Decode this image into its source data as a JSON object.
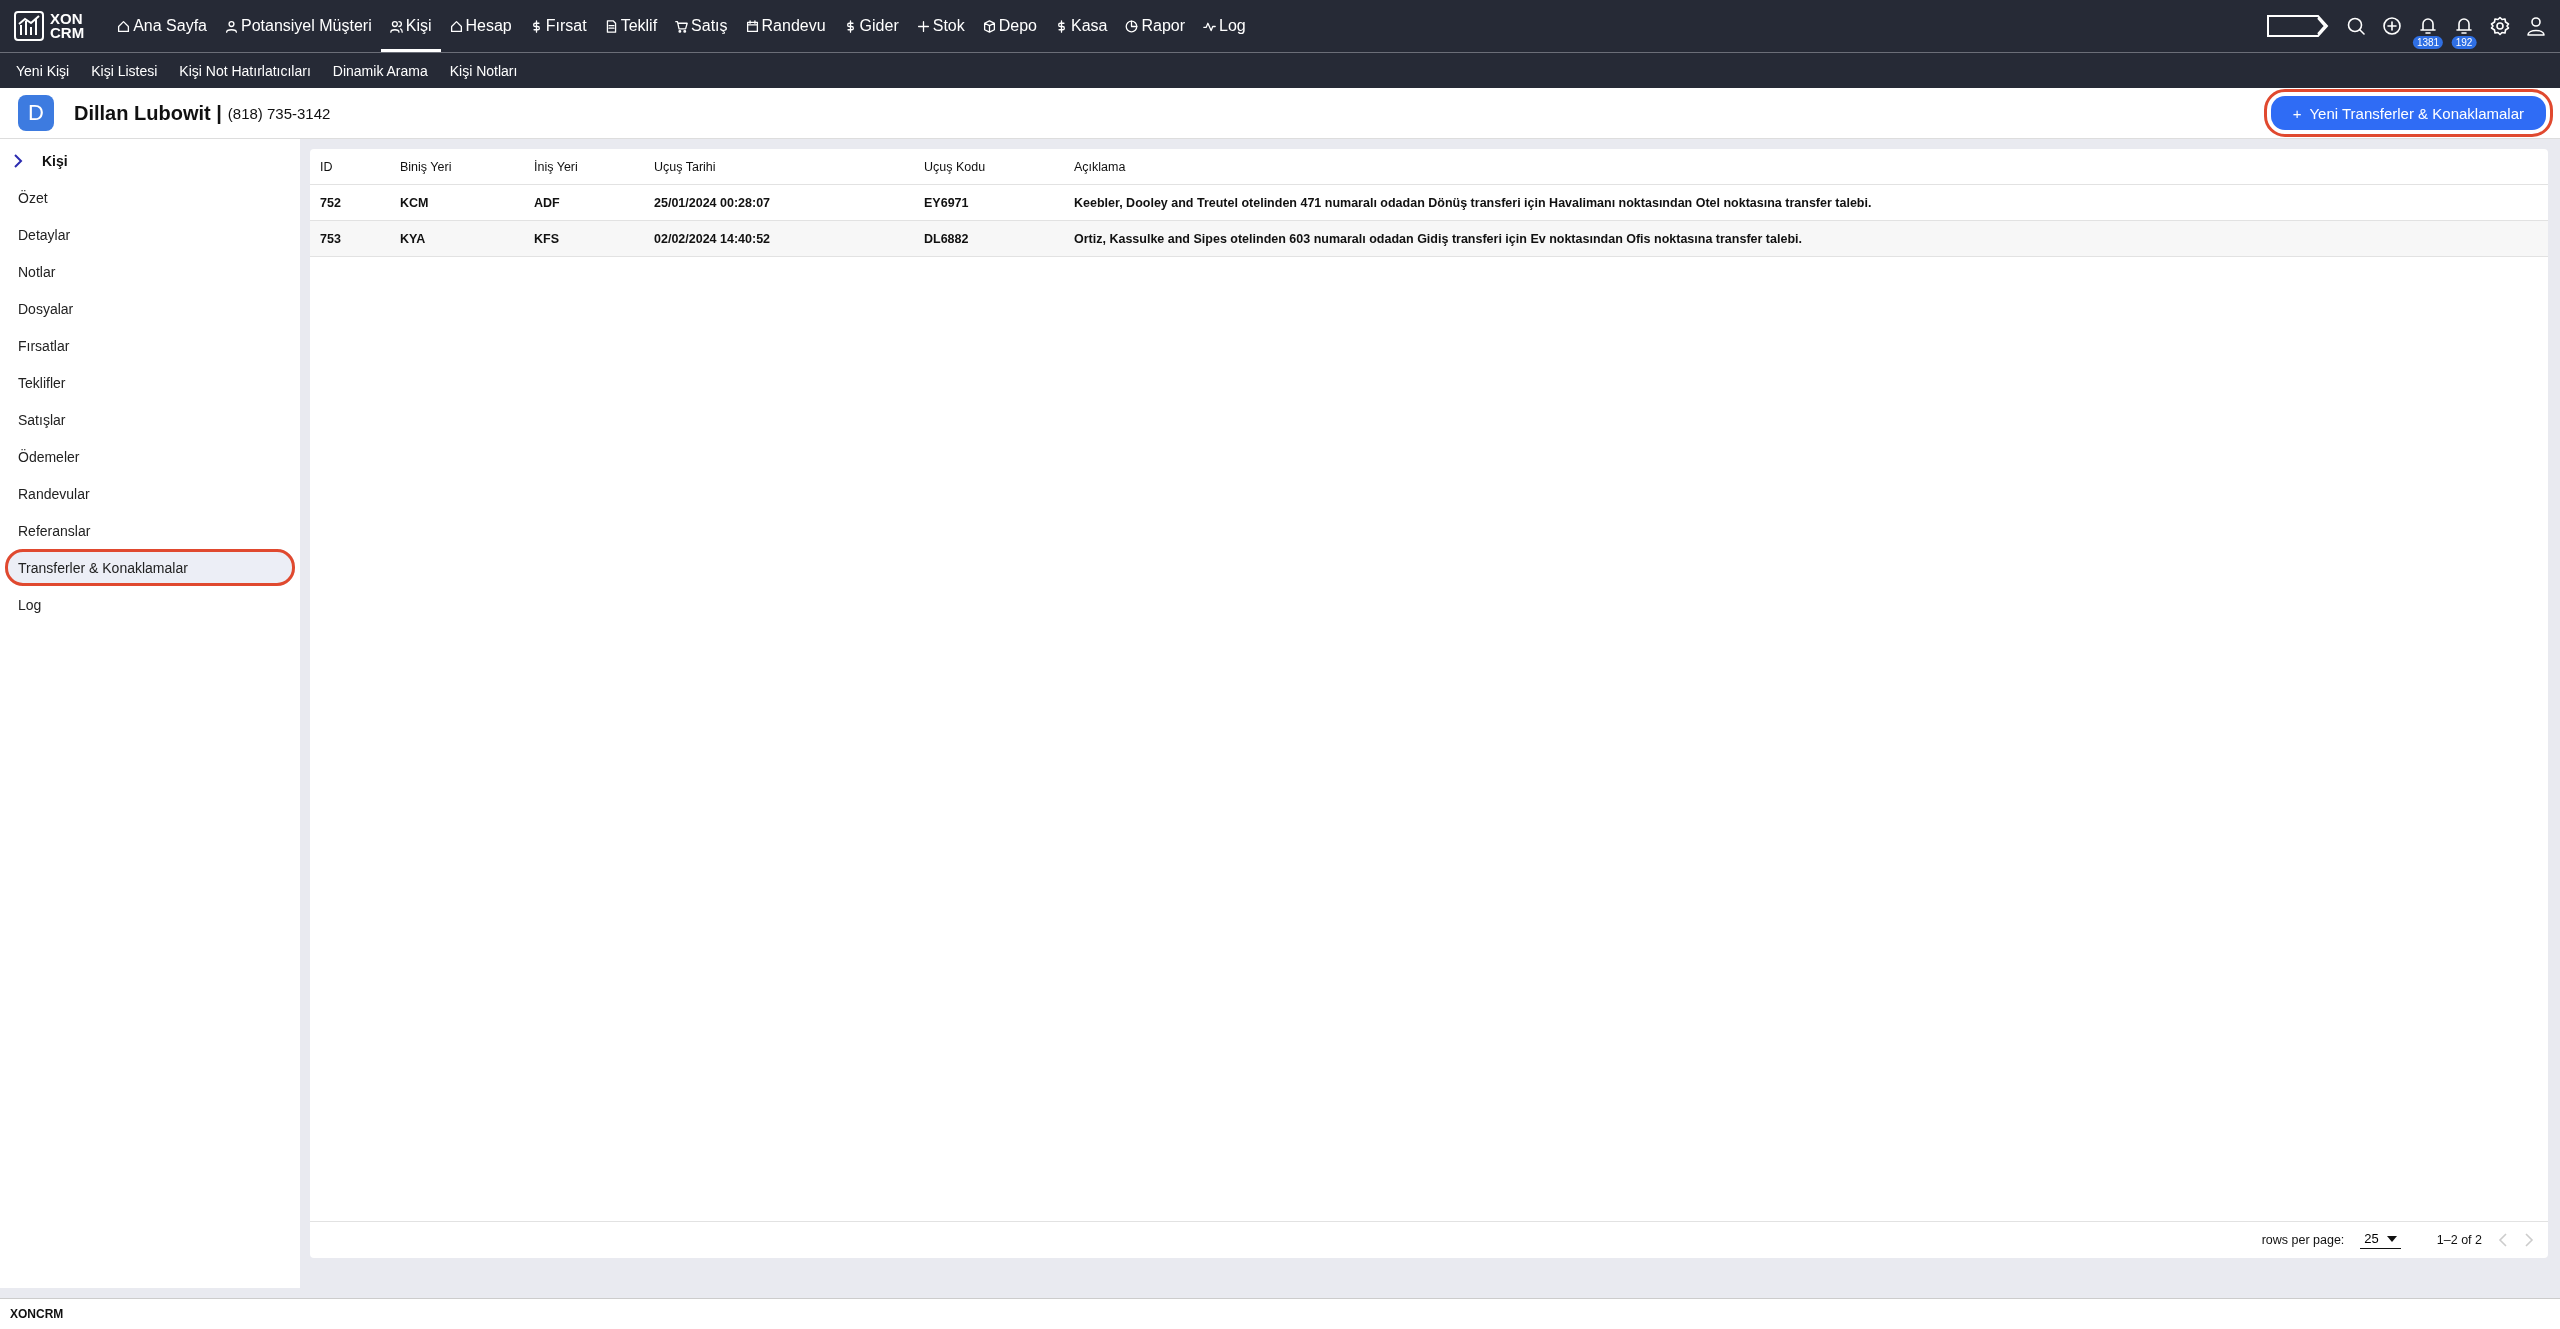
{
  "brand": {
    "line_1": "XON",
    "line_2": "CRM"
  },
  "nav": [
    {
      "label": "Ana Sayfa",
      "kind": "home",
      "selected": false
    },
    {
      "label": "Potansiyel Müşteri",
      "kind": "person",
      "selected": false
    },
    {
      "label": "Kişi",
      "kind": "people",
      "selected": true
    },
    {
      "label": "Hesap",
      "kind": "home",
      "selected": false
    },
    {
      "label": "Fırsat",
      "kind": "dollar",
      "selected": false
    },
    {
      "label": "Teklif",
      "kind": "doc",
      "selected": false
    },
    {
      "label": "Satış",
      "kind": "cart",
      "selected": false
    },
    {
      "label": "Randevu",
      "kind": "calendar",
      "selected": false
    },
    {
      "label": "Gider",
      "kind": "dollar",
      "selected": false
    },
    {
      "label": "Stok",
      "kind": "plus",
      "selected": false
    },
    {
      "label": "Depo",
      "kind": "box",
      "selected": false
    },
    {
      "label": "Kasa",
      "kind": "dollar",
      "selected": false
    },
    {
      "label": "Rapor",
      "kind": "clock",
      "selected": false
    },
    {
      "label": "Log",
      "kind": "pulse",
      "selected": false
    }
  ],
  "toolbar": [
    {
      "kind": "arrow"
    },
    {
      "kind": "search"
    },
    {
      "kind": "add"
    },
    {
      "kind": "bell",
      "badge": "1381"
    },
    {
      "kind": "bell",
      "badge": "192"
    },
    {
      "kind": "settings"
    },
    {
      "kind": "user"
    }
  ],
  "subnav": [
    "Yeni Kişi",
    "Kişi Listesi",
    "Kişi Not Hatırlatıcıları",
    "Dinamik Arama",
    "Kişi Notları"
  ],
  "contact": {
    "initial": "D",
    "name": "Dillan Lubowit |",
    "phone": "(818) 735-3142"
  },
  "new_button": {
    "icon": "+",
    "label": "Yeni Transferler & Konaklamalar",
    "annotated": true
  },
  "sidebar": {
    "title": "Kişi",
    "items": [
      {
        "label": "Özet",
        "selected": false,
        "annotated": false
      },
      {
        "label": "Detaylar",
        "selected": false,
        "annotated": false
      },
      {
        "label": "Notlar",
        "selected": false,
        "annotated": false
      },
      {
        "label": "Dosyalar",
        "selected": false,
        "annotated": false
      },
      {
        "label": "Fırsatlar",
        "selected": false,
        "annotated": false
      },
      {
        "label": "Teklifler",
        "selected": false,
        "annotated": false
      },
      {
        "label": "Satışlar",
        "selected": false,
        "annotated": false
      },
      {
        "label": "Ödemeler",
        "selected": false,
        "annotated": false
      },
      {
        "label": "Randevular",
        "selected": false,
        "annotated": false
      },
      {
        "label": "Referanslar",
        "selected": false,
        "annotated": false
      },
      {
        "label": "Transferler & Konaklamalar",
        "selected": true,
        "annotated": true
      },
      {
        "label": "Log",
        "selected": false,
        "annotated": false
      }
    ]
  },
  "table": {
    "columns": [
      "ID",
      "Biniş Yeri",
      "İniş Yeri",
      "Uçuş Tarihi",
      "Uçuş Kodu",
      "Açıklama"
    ],
    "rows": [
      [
        "752",
        "KCM",
        "ADF",
        "25/01/2024 00:28:07",
        "EY6971",
        "Keebler, Dooley and Treutel otelinden 471 numaralı odadan Dönüş transferi için Havalimanı noktasından Otel noktasına transfer talebi."
      ],
      [
        "753",
        "KYA",
        "KFS",
        "02/02/2024 14:40:52",
        "DL6882",
        "Ortiz, Kassulke and Sipes otelinden 603 numaralı odadan Gidiş transferi için Ev noktasından Ofis noktasına transfer talebi."
      ]
    ]
  },
  "pagination": {
    "rows_label": "rows per page:",
    "rows_value": "25",
    "range": "1–2 of 2"
  },
  "status_bar": "XONCRM"
}
